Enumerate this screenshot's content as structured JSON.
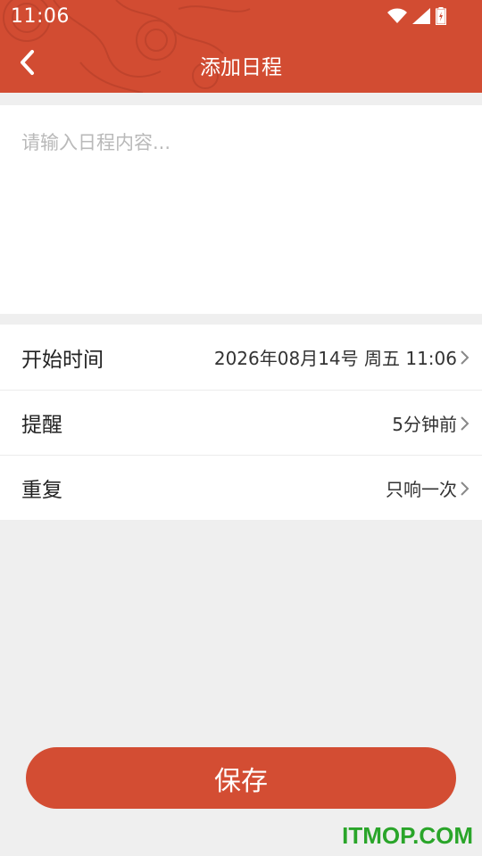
{
  "status_bar": {
    "time": "11:06",
    "icons": [
      "wifi-icon",
      "signal-icon",
      "battery-icon"
    ]
  },
  "nav": {
    "title": "添加日程",
    "back_icon": "chevron-left-icon"
  },
  "content": {
    "placeholder": "请输入日程内容..."
  },
  "settings": {
    "start_time": {
      "label": "开始时间",
      "value": "2026年08月14号 周五 11:06"
    },
    "reminder": {
      "label": "提醒",
      "value": "5分钟前"
    },
    "repeat": {
      "label": "重复",
      "value": "只响一次"
    }
  },
  "save_button": {
    "label": "保存"
  },
  "watermark": "ITMOP.COM",
  "colors": {
    "header": "#d24c32",
    "button": "#d34d33",
    "background": "#efefef",
    "watermark": "#2aa52a"
  }
}
